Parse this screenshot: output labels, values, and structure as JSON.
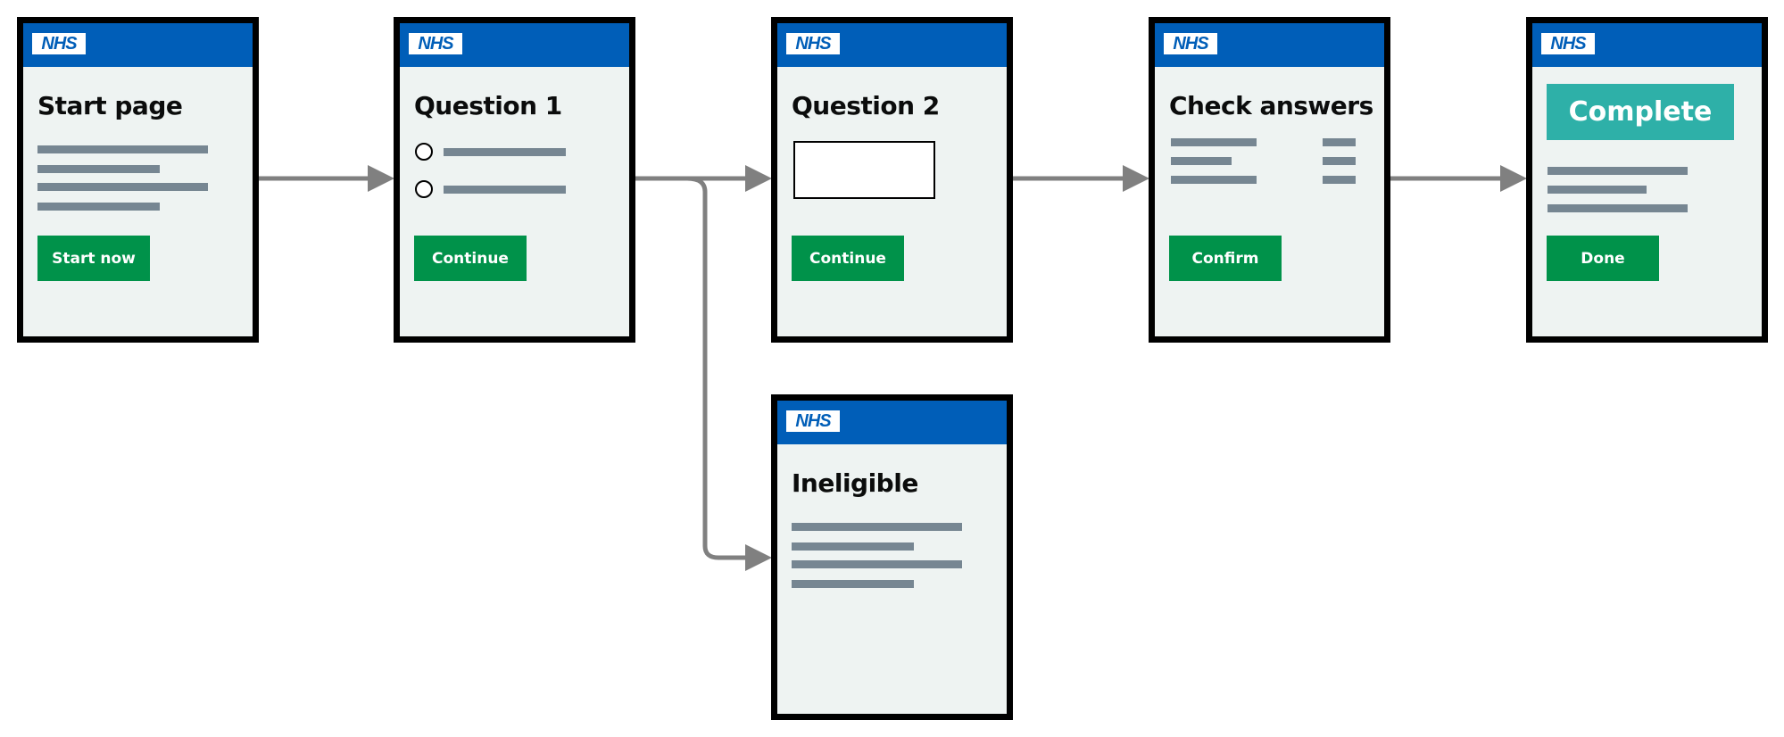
{
  "logo_text": "NHS",
  "colors": {
    "header": "#005eb8",
    "button": "#00924a",
    "panel": "#2eb0a8",
    "arrow": "#808080",
    "text_lines": "#768692"
  },
  "pages": [
    {
      "title": "Start page",
      "button": "Start now"
    },
    {
      "title": "Question 1",
      "button": "Continue"
    },
    {
      "title": "Question 2",
      "button": "Continue"
    },
    {
      "title": "Check answers",
      "button": "Confirm"
    },
    {
      "panel": "Complete",
      "button": "Done"
    },
    {
      "title": "Ineligible"
    }
  ]
}
